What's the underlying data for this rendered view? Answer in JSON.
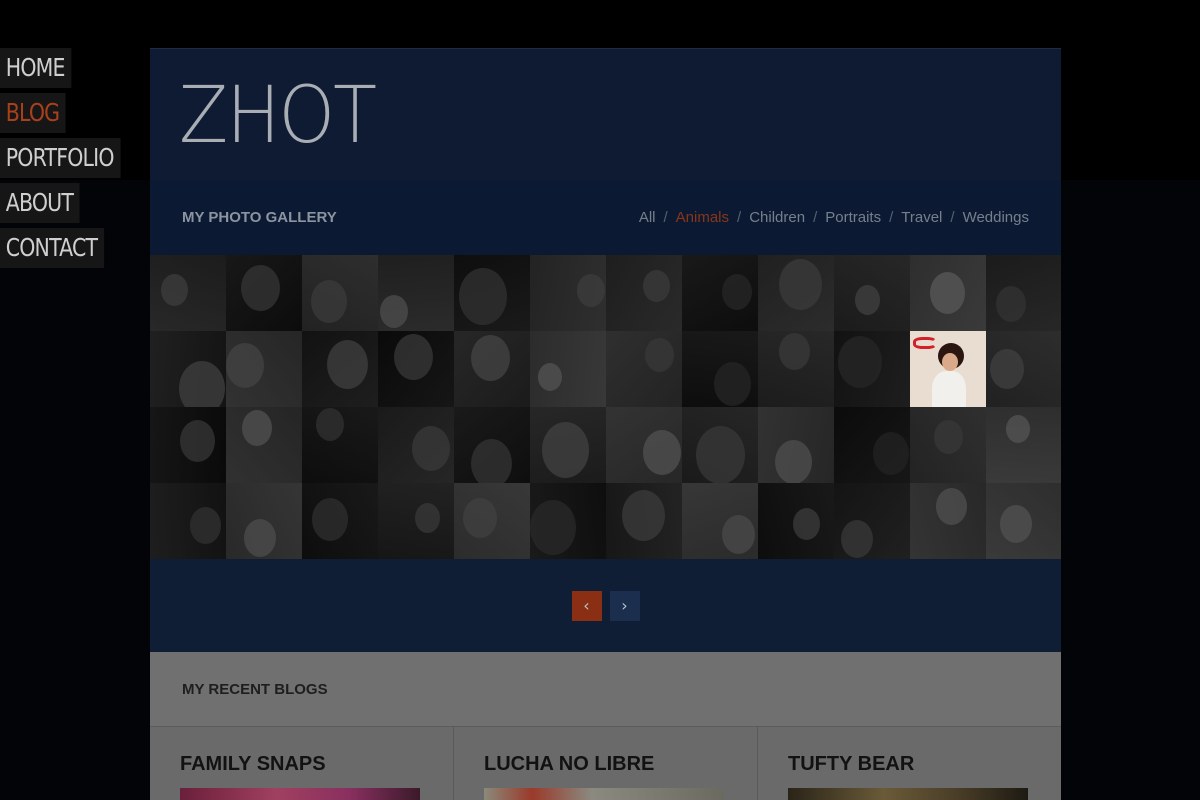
{
  "nav": {
    "items": [
      {
        "label": "HOME",
        "active": false
      },
      {
        "label": "BLOG",
        "active": true
      },
      {
        "label": "PORTFOLIO",
        "active": false
      },
      {
        "label": "ABOUT",
        "active": false
      },
      {
        "label": "CONTACT",
        "active": false
      }
    ]
  },
  "header": {
    "logo": "ZHOT"
  },
  "gallery": {
    "title": "MY PHOTO GALLERY",
    "filters": [
      {
        "label": "All",
        "active": false
      },
      {
        "label": "Animals",
        "active": true
      },
      {
        "label": "Children",
        "active": false
      },
      {
        "label": "Portraits",
        "active": false
      },
      {
        "label": "Travel",
        "active": false
      },
      {
        "label": "Weddings",
        "active": false
      }
    ],
    "separator": "/",
    "highlighted_thumb_index": 22
  },
  "pager": {
    "prev_icon": "chevron-left-icon",
    "next_icon": "chevron-right-icon"
  },
  "blogs": {
    "title": "MY RECENT BLOGS",
    "items": [
      {
        "title": "FAMILY SNAPS"
      },
      {
        "title": "LUCHA NO LIBRE"
      },
      {
        "title": "TUFTY BEAR"
      }
    ]
  },
  "colors": {
    "accent": "#a8401c",
    "panel": "#0e1b33"
  }
}
